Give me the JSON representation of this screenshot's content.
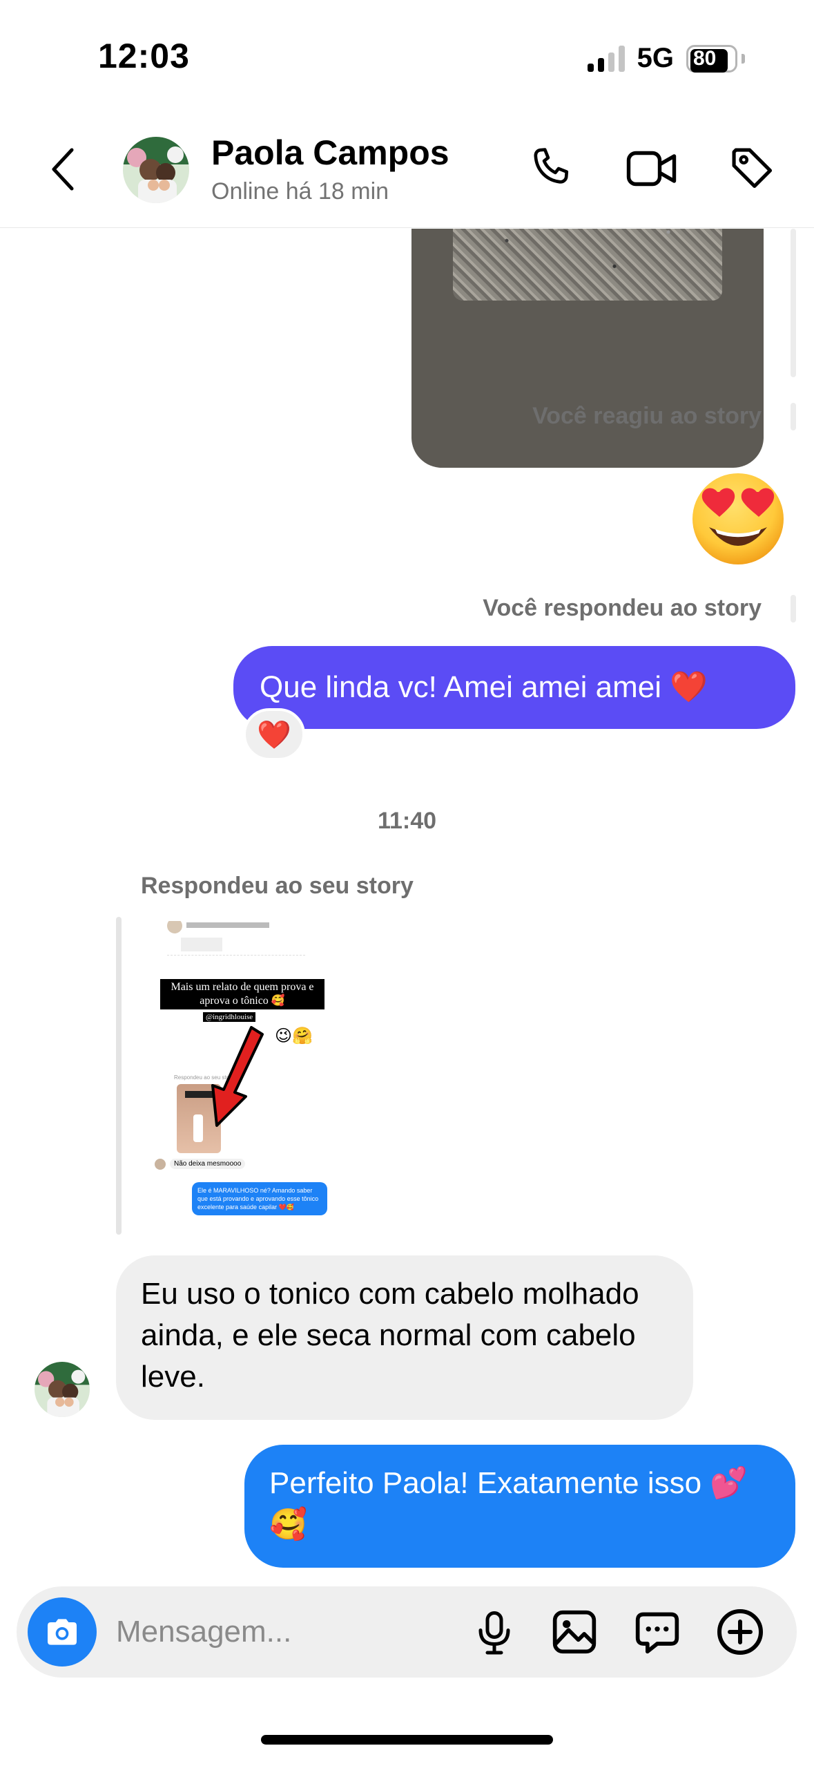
{
  "status_bar": {
    "time": "12:03",
    "network": "5G",
    "battery": "80"
  },
  "header": {
    "name": "Paola Campos",
    "status": "Online há 18 min"
  },
  "chat": {
    "reacted_label": "Você reagiu ao story",
    "reaction_emoji": "😍",
    "replied_label": "Você respondeu ao story",
    "msg_out_1": "Que linda vc! Amei amei amei ❤️",
    "msg_out_1_reaction": "❤️",
    "timestamp": "11:40",
    "replied_to_your_story": "Respondeu ao seu story",
    "story_preview": {
      "headline": "Mais um relato de quem prova e aprova o tônico 🥰",
      "handle": "@ingridhlouise",
      "emojis": "😉🤗",
      "inner_label": "Respondeu ao seu story",
      "inner_reply": "Não deixa mesmoooo",
      "inner_message": "Ele é MARAVILHOSO né? Amando saber que está provando e aprovando esse tônico excelente para saúde capilar ❤️🥰"
    },
    "msg_in_1": "Eu uso o tonico com cabelo molhado ainda, e ele seca normal com cabelo leve.",
    "msg_out_2": "Perfeito Paola! Exatamente isso 💕 🥰"
  },
  "composer": {
    "placeholder": "Mensagem..."
  },
  "colors": {
    "purple_bubble": "#5b4cf5",
    "blue_bubble": "#1d82f6",
    "incoming_bubble": "#efefef"
  }
}
